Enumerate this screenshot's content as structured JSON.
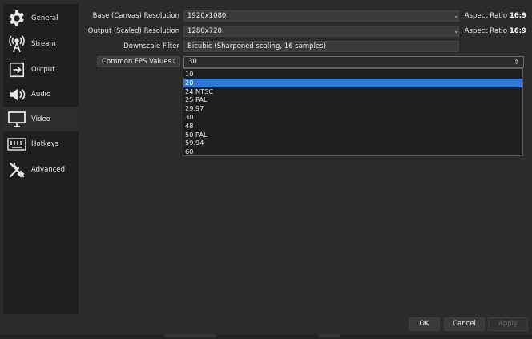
{
  "sidebar": {
    "items": [
      {
        "label": "General",
        "icon": "gear-icon"
      },
      {
        "label": "Stream",
        "icon": "antenna-icon"
      },
      {
        "label": "Output",
        "icon": "output-icon"
      },
      {
        "label": "Audio",
        "icon": "speaker-icon"
      },
      {
        "label": "Video",
        "icon": "monitor-icon"
      },
      {
        "label": "Hotkeys",
        "icon": "keyboard-icon"
      },
      {
        "label": "Advanced",
        "icon": "tools-icon"
      }
    ],
    "active": "Video"
  },
  "video": {
    "base_label": "Base (Canvas) Resolution",
    "base_value": "1920x1080",
    "base_aspect_prefix": "Aspect Ratio",
    "base_aspect_value": "16:9",
    "output_label": "Output (Scaled) Resolution",
    "output_value": "1280x720",
    "output_aspect_prefix": "Aspect Ratio",
    "output_aspect_value": "16:9",
    "downscale_label": "Downscale Filter",
    "downscale_value": "Bicubic (Sharpened scaling, 16 samples)",
    "fps_type": "Common FPS Values",
    "fps_value": "30",
    "fps_options": [
      "10",
      "20",
      "24 NTSC",
      "25 PAL",
      "29.97",
      "30",
      "48",
      "50 PAL",
      "59.94",
      "60"
    ],
    "fps_highlighted": "20"
  },
  "buttons": {
    "ok": "OK",
    "cancel": "Cancel",
    "apply": "Apply"
  },
  "colors": {
    "background": "#2b2b2b",
    "sidebar": "#1f1f1f",
    "highlight": "#2f78d6"
  }
}
